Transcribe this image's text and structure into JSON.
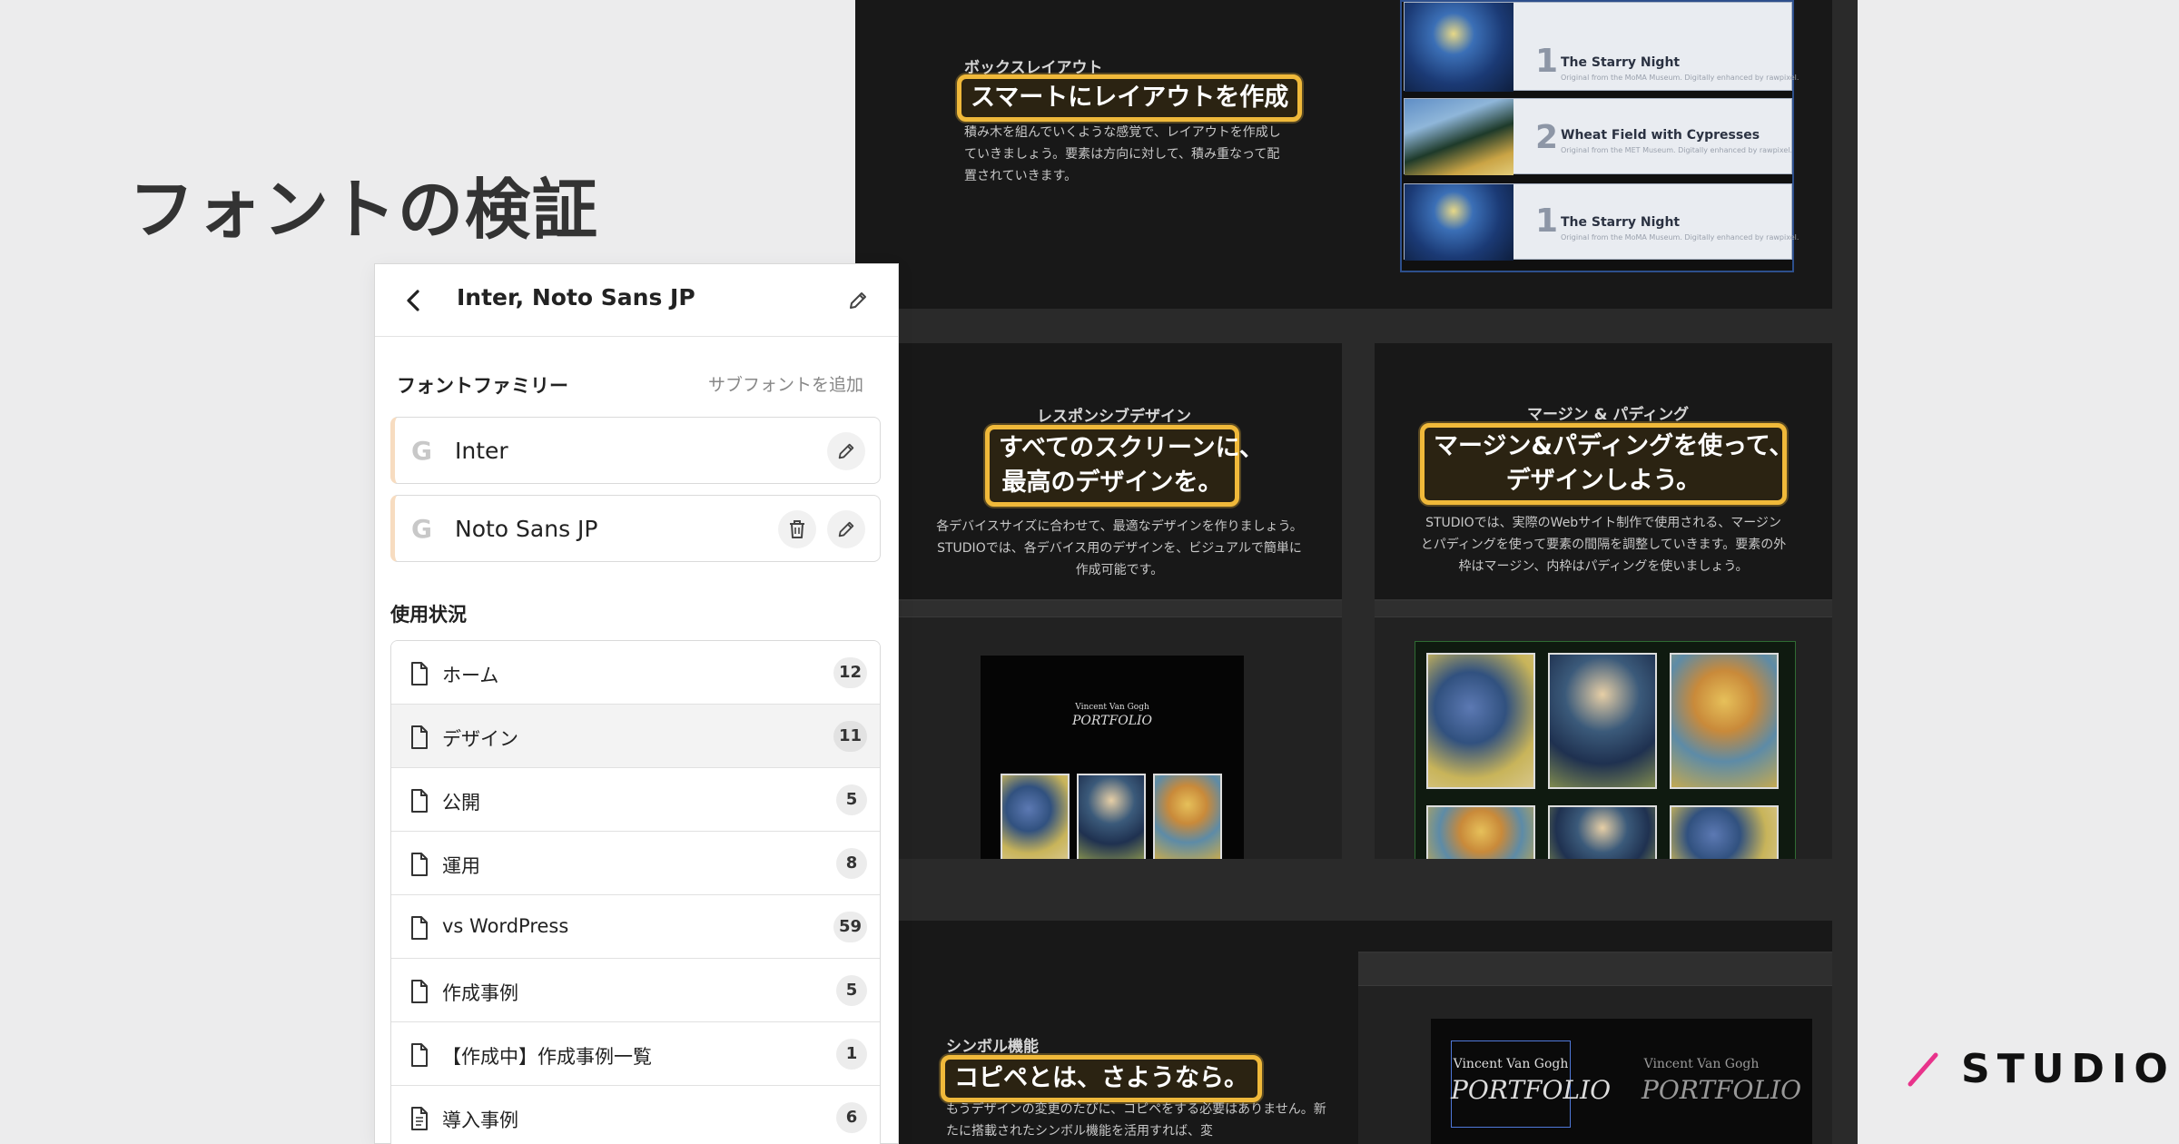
{
  "page": {
    "title": "フォントの検証"
  },
  "panel": {
    "title": "Inter, Noto Sans JP",
    "font_family_label": "フォントファミリー",
    "add_subfont_label": "サブフォントを追加",
    "fonts": [
      {
        "icon": "G",
        "name": "Inter"
      },
      {
        "icon": "G",
        "name": "Noto Sans JP"
      }
    ],
    "usage_label": "使用状況",
    "usage": [
      {
        "label": "ホーム",
        "count": "12"
      },
      {
        "label": "デザイン",
        "count": "11"
      },
      {
        "label": "公開",
        "count": "5"
      },
      {
        "label": "運用",
        "count": "8"
      },
      {
        "label": "vs WordPress",
        "count": "59"
      },
      {
        "label": "作成事例",
        "count": "5"
      },
      {
        "label": "【作成中】作成事例一覧",
        "count": "1"
      },
      {
        "label": "導入事例",
        "count": "6"
      }
    ]
  },
  "canvas": {
    "box": {
      "label": "ボックスレイアウト",
      "heading": "スマートにレイアウトを作成",
      "body": "積み木を組んでいくような感覚で、レイアウトを作成していきましょう。要素は方向に対して、積み重なって配置されていきます。",
      "rows": [
        {
          "num": "1",
          "title": "The Starry Night",
          "sub": "Original from the MoMA Museum. Digitally enhanced by rawpixel."
        },
        {
          "num": "2",
          "title": "Wheat Field with Cypresses",
          "sub": "Original from the MET Museum. Digitally enhanced by rawpixel."
        },
        {
          "num": "1",
          "title": "The Starry Night",
          "sub": "Original from the MoMA Museum. Digitally enhanced by rawpixel."
        }
      ]
    },
    "responsive": {
      "label": "レスポンシブデザイン",
      "heading_line1": "すべてのスクリーンに、",
      "heading_line2": "最高のデザインを。",
      "body": "各デバイスサイズに合わせて、最適なデザインを作りましょう。STUDIOでは、各デバイス用のデザインを、ビジュアルで簡単に作成可能です。",
      "mock_line1": "Vincent Van Gogh",
      "mock_line2": "PORTFOLIO"
    },
    "margin": {
      "label": "マージン & パディング",
      "heading_line1": "マージン&パディングを使って、",
      "heading_line2": "デザインしよう。",
      "body": "STUDIOでは、実際のWebサイト制作で使用される、マージンとパディングを使って要素の間隔を調整していきます。要素の外枠はマージン、内枠はパディングを使いましょう。"
    },
    "symbol": {
      "label": "シンボル機能",
      "heading": "コピペとは、さようなら。",
      "body": "もうデザインの変更のたびに、コピペをする必要はありません。新たに搭載されたシンボル機能を活用すれば、変",
      "mock_line1": "Vincent Van Gogh",
      "mock_line2": "PORTFOLIO"
    }
  },
  "brand": {
    "name": "STUDIO",
    "accent": "#e8338b"
  }
}
